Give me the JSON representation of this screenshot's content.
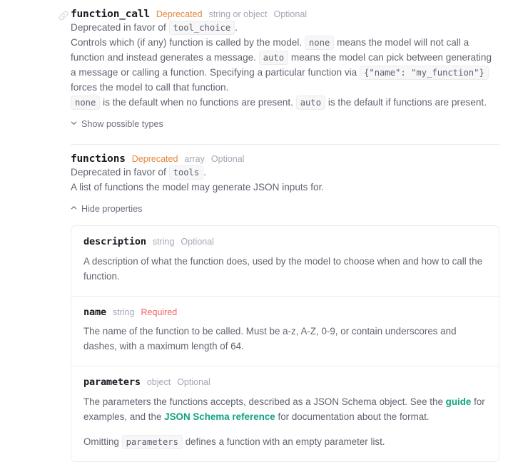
{
  "fields": [
    {
      "name": "function_call",
      "deprecated_label": "Deprecated",
      "type_label": "string or object",
      "optional_label": "Optional",
      "deprecation_prefix": "Deprecated in favor of",
      "deprecation_target": "tool_choice",
      "deprecation_suffix": ".",
      "body_1a": "Controls which (if any) function is called by the model.",
      "body_code_1": "none",
      "body_1b": "means the model will not call a function and instead generates a message.",
      "body_code_2": "auto",
      "body_1c": "means the model can pick between generating a message or calling a function. Specifying a particular function via",
      "body_code_3": "{\"name\": \"my_function\"}",
      "body_1d": "forces the model to call that function.",
      "body_2_code_1": "none",
      "body_2a": "is the default when no functions are present.",
      "body_2_code_2": "auto",
      "body_2b": "is the default if functions are present.",
      "toggle_label": "Show possible types",
      "toggle_icon": "chevron-down-icon"
    },
    {
      "name": "functions",
      "deprecated_label": "Deprecated",
      "type_label": "array",
      "optional_label": "Optional",
      "deprecation_prefix": "Deprecated in favor of",
      "deprecation_target": "tools",
      "deprecation_suffix": ".",
      "body_1a": "A list of functions the model may generate JSON inputs for.",
      "toggle_label": "Hide properties",
      "toggle_icon": "chevron-up-icon"
    }
  ],
  "properties": [
    {
      "name": "description",
      "type_label": "string",
      "required_label": "Optional",
      "required_state": "optional",
      "desc": "A description of what the function does, used by the model to choose when and how to call the function."
    },
    {
      "name": "name",
      "type_label": "string",
      "required_label": "Required",
      "required_state": "required",
      "desc": "The name of the function to be called. Must be a-z, A-Z, 0-9, or contain underscores and dashes, with a maximum length of 64."
    },
    {
      "name": "parameters",
      "type_label": "object",
      "required_label": "Optional",
      "required_state": "optional",
      "desc_a": "The parameters the functions accepts, described as a JSON Schema object. See the",
      "link_1": "guide",
      "desc_b": "for examples, and the",
      "link_2": "JSON Schema reference",
      "desc_c": "for documentation about the format.",
      "desc2_a": "Omitting",
      "desc2_code": "parameters",
      "desc2_b": "defines a function with an empty parameter list."
    }
  ],
  "colors": {
    "deprecated": "#e3873c",
    "required": "#f1625f",
    "link": "#10a37f",
    "text": "#60646f",
    "heading": "#1a1c23",
    "muted": "#a4a8b5",
    "border": "#ededef"
  },
  "icons": {
    "anchor": "link-icon"
  }
}
